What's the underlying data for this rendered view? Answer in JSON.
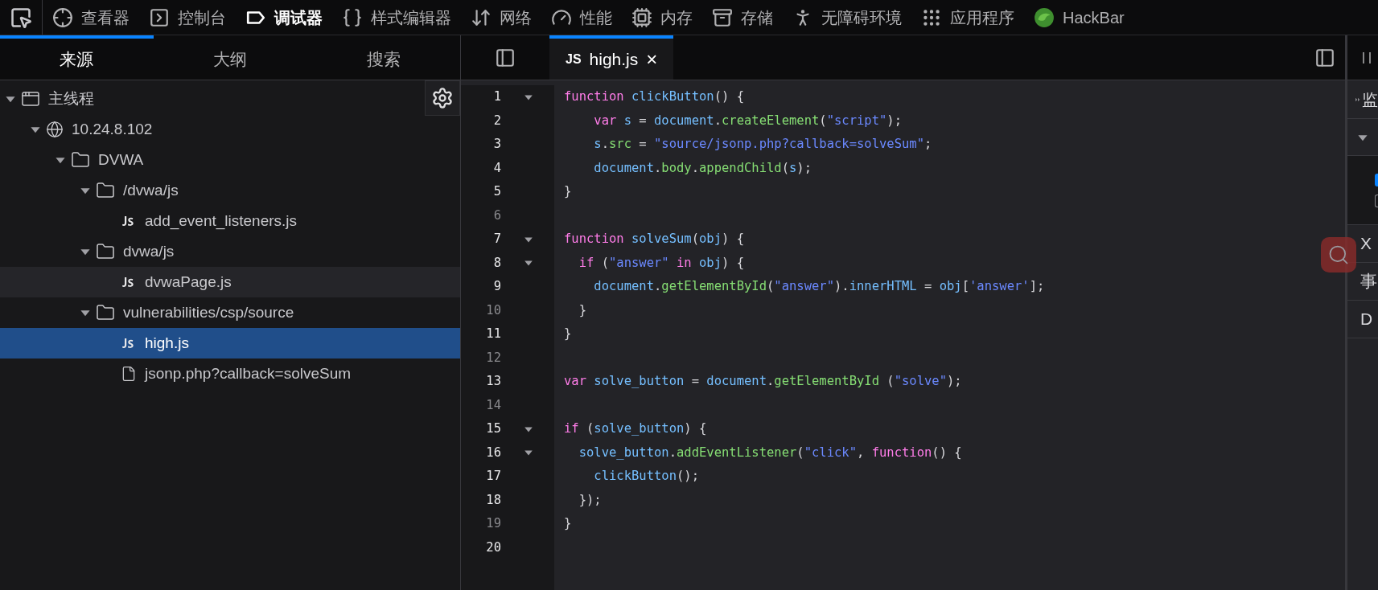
{
  "toolbar": {
    "tools": [
      {
        "label": "查看器",
        "selected": false
      },
      {
        "label": "控制台",
        "selected": false
      },
      {
        "label": "调试器",
        "selected": true
      },
      {
        "label": "样式编辑器",
        "selected": false
      },
      {
        "label": "网络",
        "selected": false
      },
      {
        "label": "性能",
        "selected": false
      },
      {
        "label": "内存",
        "selected": false
      },
      {
        "label": "存储",
        "selected": false
      },
      {
        "label": "无障碍环境",
        "selected": false
      },
      {
        "label": "应用程序",
        "selected": false
      },
      {
        "label": "HackBar",
        "selected": false
      }
    ]
  },
  "sources_panel": {
    "tabs": [
      {
        "label": "来源",
        "selected": true
      },
      {
        "label": "大纲",
        "selected": false
      },
      {
        "label": "搜索",
        "selected": false
      }
    ],
    "tree": [
      {
        "kind": "thread",
        "label": "主线程",
        "expanded": true,
        "selected": false,
        "hovered": false,
        "children": [
          {
            "kind": "host",
            "label": "10.24.8.102",
            "expanded": true,
            "selected": false,
            "hovered": false,
            "children": [
              {
                "kind": "folder",
                "label": "DVWA",
                "expanded": true,
                "selected": false,
                "hovered": false,
                "children": [
                  {
                    "kind": "folder",
                    "label": "/dvwa/js",
                    "expanded": true,
                    "selected": false,
                    "hovered": false,
                    "children": [
                      {
                        "kind": "js",
                        "label": "add_event_listeners.js",
                        "selected": false,
                        "hovered": false
                      }
                    ]
                  },
                  {
                    "kind": "folder",
                    "label": "dvwa/js",
                    "expanded": true,
                    "selected": false,
                    "hovered": false,
                    "children": [
                      {
                        "kind": "js",
                        "label": "dvwaPage.js",
                        "selected": false,
                        "hovered": true
                      }
                    ]
                  },
                  {
                    "kind": "folder",
                    "label": "vulnerabilities/csp/source",
                    "expanded": true,
                    "selected": false,
                    "hovered": false,
                    "children": [
                      {
                        "kind": "js",
                        "label": "high.js",
                        "selected": true,
                        "hovered": false
                      },
                      {
                        "kind": "file",
                        "label": "jsonp.php?callback=solveSum",
                        "selected": false,
                        "hovered": false
                      }
                    ]
                  }
                ]
              }
            ]
          }
        ]
      }
    ]
  },
  "editor": {
    "tabs": [
      {
        "badge": "JS",
        "label": "high.js",
        "close": "×",
        "selected": true
      }
    ],
    "lines": [
      {
        "number": "1",
        "breakable": true,
        "foldable": true,
        "tokens": [
          {
            "kind": "keyword",
            "text": "function"
          },
          {
            "kind": "variable",
            "text": " clickButton"
          },
          {
            "kind": "plain",
            "text": "() {"
          }
        ]
      },
      {
        "number": "2",
        "breakable": true,
        "foldable": false,
        "tokens": [
          {
            "kind": "keyword",
            "text": "    var"
          },
          {
            "kind": "variable",
            "text": " s"
          },
          {
            "kind": "plain",
            "text": " = "
          },
          {
            "kind": "variable",
            "text": "document"
          },
          {
            "kind": "plain",
            "text": "."
          },
          {
            "kind": "property",
            "text": "createElement"
          },
          {
            "kind": "plain",
            "text": "("
          },
          {
            "kind": "string",
            "text": "\"script\""
          },
          {
            "kind": "plain",
            "text": ");"
          }
        ]
      },
      {
        "number": "3",
        "breakable": true,
        "foldable": false,
        "tokens": [
          {
            "kind": "variable",
            "text": "    s"
          },
          {
            "kind": "plain",
            "text": "."
          },
          {
            "kind": "property",
            "text": "src"
          },
          {
            "kind": "plain",
            "text": " = "
          },
          {
            "kind": "string",
            "text": "\"source/jsonp.php?callback=solveSum\""
          },
          {
            "kind": "plain",
            "text": ";"
          }
        ]
      },
      {
        "number": "4",
        "breakable": true,
        "foldable": false,
        "tokens": [
          {
            "kind": "variable",
            "text": "    document"
          },
          {
            "kind": "plain",
            "text": "."
          },
          {
            "kind": "property",
            "text": "body"
          },
          {
            "kind": "plain",
            "text": "."
          },
          {
            "kind": "property",
            "text": "appendChild"
          },
          {
            "kind": "plain",
            "text": "("
          },
          {
            "kind": "variable",
            "text": "s"
          },
          {
            "kind": "plain",
            "text": ");"
          }
        ]
      },
      {
        "number": "5",
        "breakable": true,
        "foldable": false,
        "tokens": [
          {
            "kind": "plain",
            "text": "}"
          }
        ]
      },
      {
        "number": "6",
        "breakable": false,
        "foldable": false
      },
      {
        "number": "7",
        "breakable": true,
        "foldable": true,
        "tokens": [
          {
            "kind": "keyword",
            "text": "function"
          },
          {
            "kind": "variable",
            "text": " solveSum"
          },
          {
            "kind": "plain",
            "text": "("
          },
          {
            "kind": "variable",
            "text": "obj"
          },
          {
            "kind": "plain",
            "text": ") {"
          }
        ]
      },
      {
        "number": "8",
        "breakable": true,
        "foldable": true,
        "tokens": [
          {
            "kind": "keyword",
            "text": "  if"
          },
          {
            "kind": "plain",
            "text": " ("
          },
          {
            "kind": "string",
            "text": "\"answer\""
          },
          {
            "kind": "keyword",
            "text": " in"
          },
          {
            "kind": "variable",
            "text": " obj"
          },
          {
            "kind": "plain",
            "text": ") {"
          }
        ]
      },
      {
        "number": "9",
        "breakable": true,
        "foldable": false,
        "tokens": [
          {
            "kind": "variable",
            "text": "    document"
          },
          {
            "kind": "plain",
            "text": "."
          },
          {
            "kind": "property",
            "text": "getElementById"
          },
          {
            "kind": "plain",
            "text": "("
          },
          {
            "kind": "string",
            "text": "\"answer\""
          },
          {
            "kind": "plain",
            "text": ")."
          },
          {
            "kind": "variable",
            "text": "innerHTML"
          },
          {
            "kind": "plain",
            "text": " = "
          },
          {
            "kind": "variable",
            "text": "obj"
          },
          {
            "kind": "plain",
            "text": "["
          },
          {
            "kind": "string",
            "text": "'answer'"
          },
          {
            "kind": "plain",
            "text": "];"
          }
        ]
      },
      {
        "number": "10",
        "breakable": false,
        "foldable": false,
        "tokens": [
          {
            "kind": "plain",
            "text": "  }"
          }
        ]
      },
      {
        "number": "11",
        "breakable": true,
        "foldable": false,
        "tokens": [
          {
            "kind": "plain",
            "text": "}"
          }
        ]
      },
      {
        "number": "12",
        "breakable": false,
        "foldable": false
      },
      {
        "number": "13",
        "breakable": true,
        "foldable": false,
        "tokens": [
          {
            "kind": "keyword",
            "text": "var"
          },
          {
            "kind": "variable",
            "text": " solve_button"
          },
          {
            "kind": "plain",
            "text": " = "
          },
          {
            "kind": "variable",
            "text": "document"
          },
          {
            "kind": "plain",
            "text": "."
          },
          {
            "kind": "property",
            "text": "getElementById"
          },
          {
            "kind": "plain",
            "text": " ("
          },
          {
            "kind": "string",
            "text": "\"solve\""
          },
          {
            "kind": "plain",
            "text": ");"
          }
        ]
      },
      {
        "number": "14",
        "breakable": false,
        "foldable": false
      },
      {
        "number": "15",
        "breakable": true,
        "foldable": true,
        "tokens": [
          {
            "kind": "keyword",
            "text": "if"
          },
          {
            "kind": "plain",
            "text": " ("
          },
          {
            "kind": "variable",
            "text": "solve_button"
          },
          {
            "kind": "plain",
            "text": ") {"
          }
        ]
      },
      {
        "number": "16",
        "breakable": true,
        "foldable": true,
        "tokens": [
          {
            "kind": "variable",
            "text": "  solve_button"
          },
          {
            "kind": "plain",
            "text": "."
          },
          {
            "kind": "property",
            "text": "addEventListener"
          },
          {
            "kind": "plain",
            "text": "("
          },
          {
            "kind": "string",
            "text": "\"click\""
          },
          {
            "kind": "plain",
            "text": ", "
          },
          {
            "kind": "keyword",
            "text": "function"
          },
          {
            "kind": "plain",
            "text": "() {"
          }
        ]
      },
      {
        "number": "17",
        "breakable": true,
        "foldable": false,
        "tokens": [
          {
            "kind": "variable",
            "text": "    clickButton"
          },
          {
            "kind": "plain",
            "text": "();"
          }
        ]
      },
      {
        "number": "18",
        "breakable": true,
        "foldable": false,
        "tokens": [
          {
            "kind": "plain",
            "text": "  });"
          }
        ]
      },
      {
        "number": "19",
        "breakable": false,
        "foldable": false,
        "tokens": [
          {
            "kind": "plain",
            "text": "}"
          }
        ]
      },
      {
        "number": "20",
        "breakable": true,
        "foldable": false
      }
    ]
  },
  "side_panel": {
    "watch_label": "监",
    "checkboxes": [
      {
        "checked": true
      },
      {
        "checked": false
      }
    ],
    "sections": [
      "X",
      "事",
      "D"
    ]
  }
}
